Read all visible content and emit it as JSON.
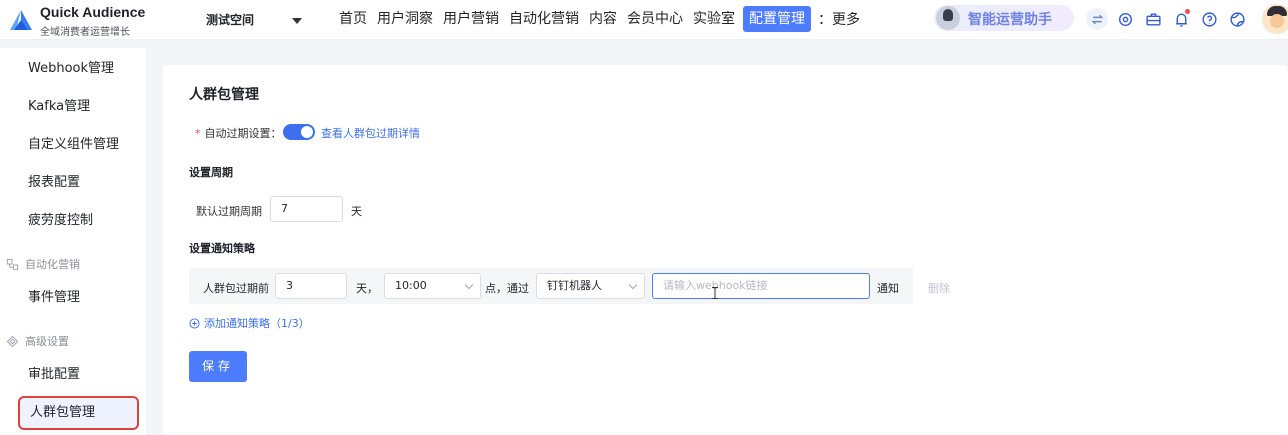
{
  "brand": {
    "title": "Quick Audience",
    "subtitle": "全域消费者运营增长"
  },
  "workspace": {
    "name": "测试空间"
  },
  "nav": {
    "items": [
      "首页",
      "用户洞察",
      "用户营销",
      "自动化营销",
      "内容",
      "会员中心",
      "实验室",
      "配置管理"
    ],
    "active": "配置管理",
    "more": "：更多"
  },
  "assistant": {
    "label": "智能运营助手"
  },
  "sidebar": {
    "items": [
      {
        "label": "Webhook管理"
      },
      {
        "label": "Kafka管理"
      },
      {
        "label": "自定义组件管理"
      },
      {
        "label": "报表配置"
      },
      {
        "label": "疲劳度控制"
      }
    ],
    "group_automation": "自动化营销",
    "automation_items": [
      {
        "label": "事件管理"
      }
    ],
    "group_advanced": "高级设置",
    "advanced_items": [
      {
        "label": "审批配置"
      },
      {
        "label": "人群包管理"
      }
    ]
  },
  "main": {
    "title": "人群包管理",
    "auto_expire": {
      "required_mark": "*",
      "label": "自动过期设置：",
      "enabled": true,
      "link": "查看人群包过期详情"
    },
    "period_section": "设置周期",
    "default_period": {
      "label": "默认过期周期",
      "value": "7",
      "unit": "天"
    },
    "notify_section": "设置通知策略",
    "strategy": {
      "prefix": "人群包过期前",
      "days": "3",
      "days_unit": "天，",
      "time": "10:00",
      "via": "点，通过",
      "channel": "钉钉机器人",
      "webhook_placeholder": "请输入webhook链接",
      "notify": "通知",
      "delete": "删除"
    },
    "add_strategy": "添加通知策略（1/3）",
    "save": "保存"
  },
  "colors": {
    "primary": "#4d7cff",
    "link": "#3d6ff0",
    "highlight_border": "#e0423a"
  }
}
